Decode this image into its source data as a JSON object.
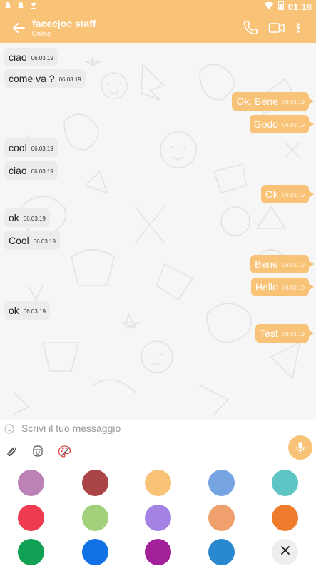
{
  "status_bar": {
    "time": "01:18",
    "icons": [
      "notification-icon",
      "notification-icon",
      "download-icon",
      "wifi-icon",
      "battery-icon"
    ]
  },
  "header": {
    "title": "facecjoc staff",
    "subtitle": "Online",
    "icons": [
      "back-arrow-icon",
      "phone-icon",
      "video-camera-icon",
      "more-vertical-icon"
    ]
  },
  "messages": [
    {
      "side": "in",
      "text": "ciao",
      "time": "06.03.19"
    },
    {
      "side": "in",
      "text": "come va ?",
      "time": "06.03.19"
    },
    {
      "side": "out",
      "text": "Ok. Bene",
      "time": "06.03.19"
    },
    {
      "side": "out",
      "text": "Godo",
      "time": "06.03.19"
    },
    {
      "side": "in",
      "text": "cool",
      "time": "06.03.19"
    },
    {
      "side": "in",
      "text": "ciao",
      "time": "06.03.19"
    },
    {
      "side": "out",
      "text": "Ok",
      "time": "06.03.19"
    },
    {
      "side": "in",
      "text": "ok",
      "time": "06.03.19"
    },
    {
      "side": "in",
      "text": "Cool",
      "time": "06.03.19"
    },
    {
      "side": "out",
      "text": "Bene",
      "time": "06.03.19"
    },
    {
      "side": "out",
      "text": "Hello",
      "time": "06.03.19"
    },
    {
      "side": "in",
      "text": "ok",
      "time": "06.03.19"
    },
    {
      "side": "out",
      "text": "Test",
      "time": "06.03.19"
    }
  ],
  "composer": {
    "placeholder": "Scrivi il tuo messaggio",
    "value": "",
    "icons": [
      "emoji-icon",
      "attach-icon",
      "sticker-icon",
      "palette-icon",
      "mic-icon"
    ]
  },
  "palette": {
    "colors": [
      "#bb82b5",
      "#a94547",
      "#f8c277",
      "#76a3e2",
      "#5ec4c4",
      "#ee3b4f",
      "#a3d07b",
      "#a482e3",
      "#f0a06c",
      "#ef7c2c",
      "#11a154",
      "#1171e6",
      "#a3209b",
      "#2a88d1"
    ],
    "close_icon": "close-icon"
  },
  "theme": {
    "accent": "#f8c277",
    "incoming_bubble": "#ececec",
    "chat_background": "#f6f6f6"
  }
}
